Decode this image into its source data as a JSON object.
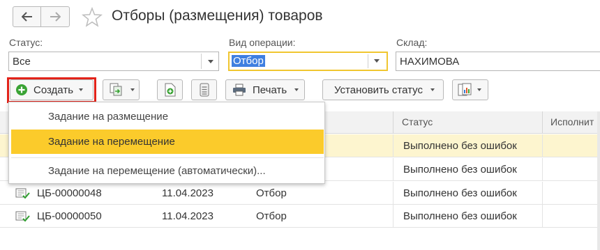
{
  "header": {
    "title": "Отборы (размещения) товаров",
    "back_icon": "arrow-left-icon",
    "forward_icon": "arrow-right-icon",
    "favorite_icon": "star-icon"
  },
  "filters": {
    "status": {
      "label": "Статус:",
      "value": "Все"
    },
    "operation": {
      "label": "Вид операции:",
      "value": "Отбор"
    },
    "warehouse": {
      "label": "Склад:",
      "value": "НАХИМОВА"
    }
  },
  "toolbar": {
    "create_label": "Создать",
    "print_label": "Печать",
    "set_status_label": "Установить статус"
  },
  "table": {
    "columns": [
      "Статус",
      "Исполнит"
    ],
    "rows": [
      {
        "number": "",
        "date": "",
        "operation": "",
        "status": "Выполнено без ошибок",
        "current": true
      },
      {
        "number": "",
        "date": "",
        "operation": "",
        "status": "Выполнено без ошибок",
        "current": false
      },
      {
        "number": "ЦБ-00000048",
        "date": "11.04.2023",
        "operation": "Отбор",
        "status": "Выполнено без ошибок",
        "current": false
      },
      {
        "number": "ЦБ-00000050",
        "date": "11.04.2023",
        "operation": "Отбор",
        "status": "Выполнено без ошибок",
        "current": false
      }
    ]
  },
  "create_menu": {
    "items": [
      "Задание на размещение",
      "Задание на перемещение",
      "Задание на перемещение (автоматически)..."
    ],
    "highlighted_index": 1
  },
  "colors": {
    "accent_yellow": "#fbcb2b",
    "current_row": "#fdf5cf",
    "focus_border": "#f0c630",
    "highlight_frame": "#e2231a"
  }
}
